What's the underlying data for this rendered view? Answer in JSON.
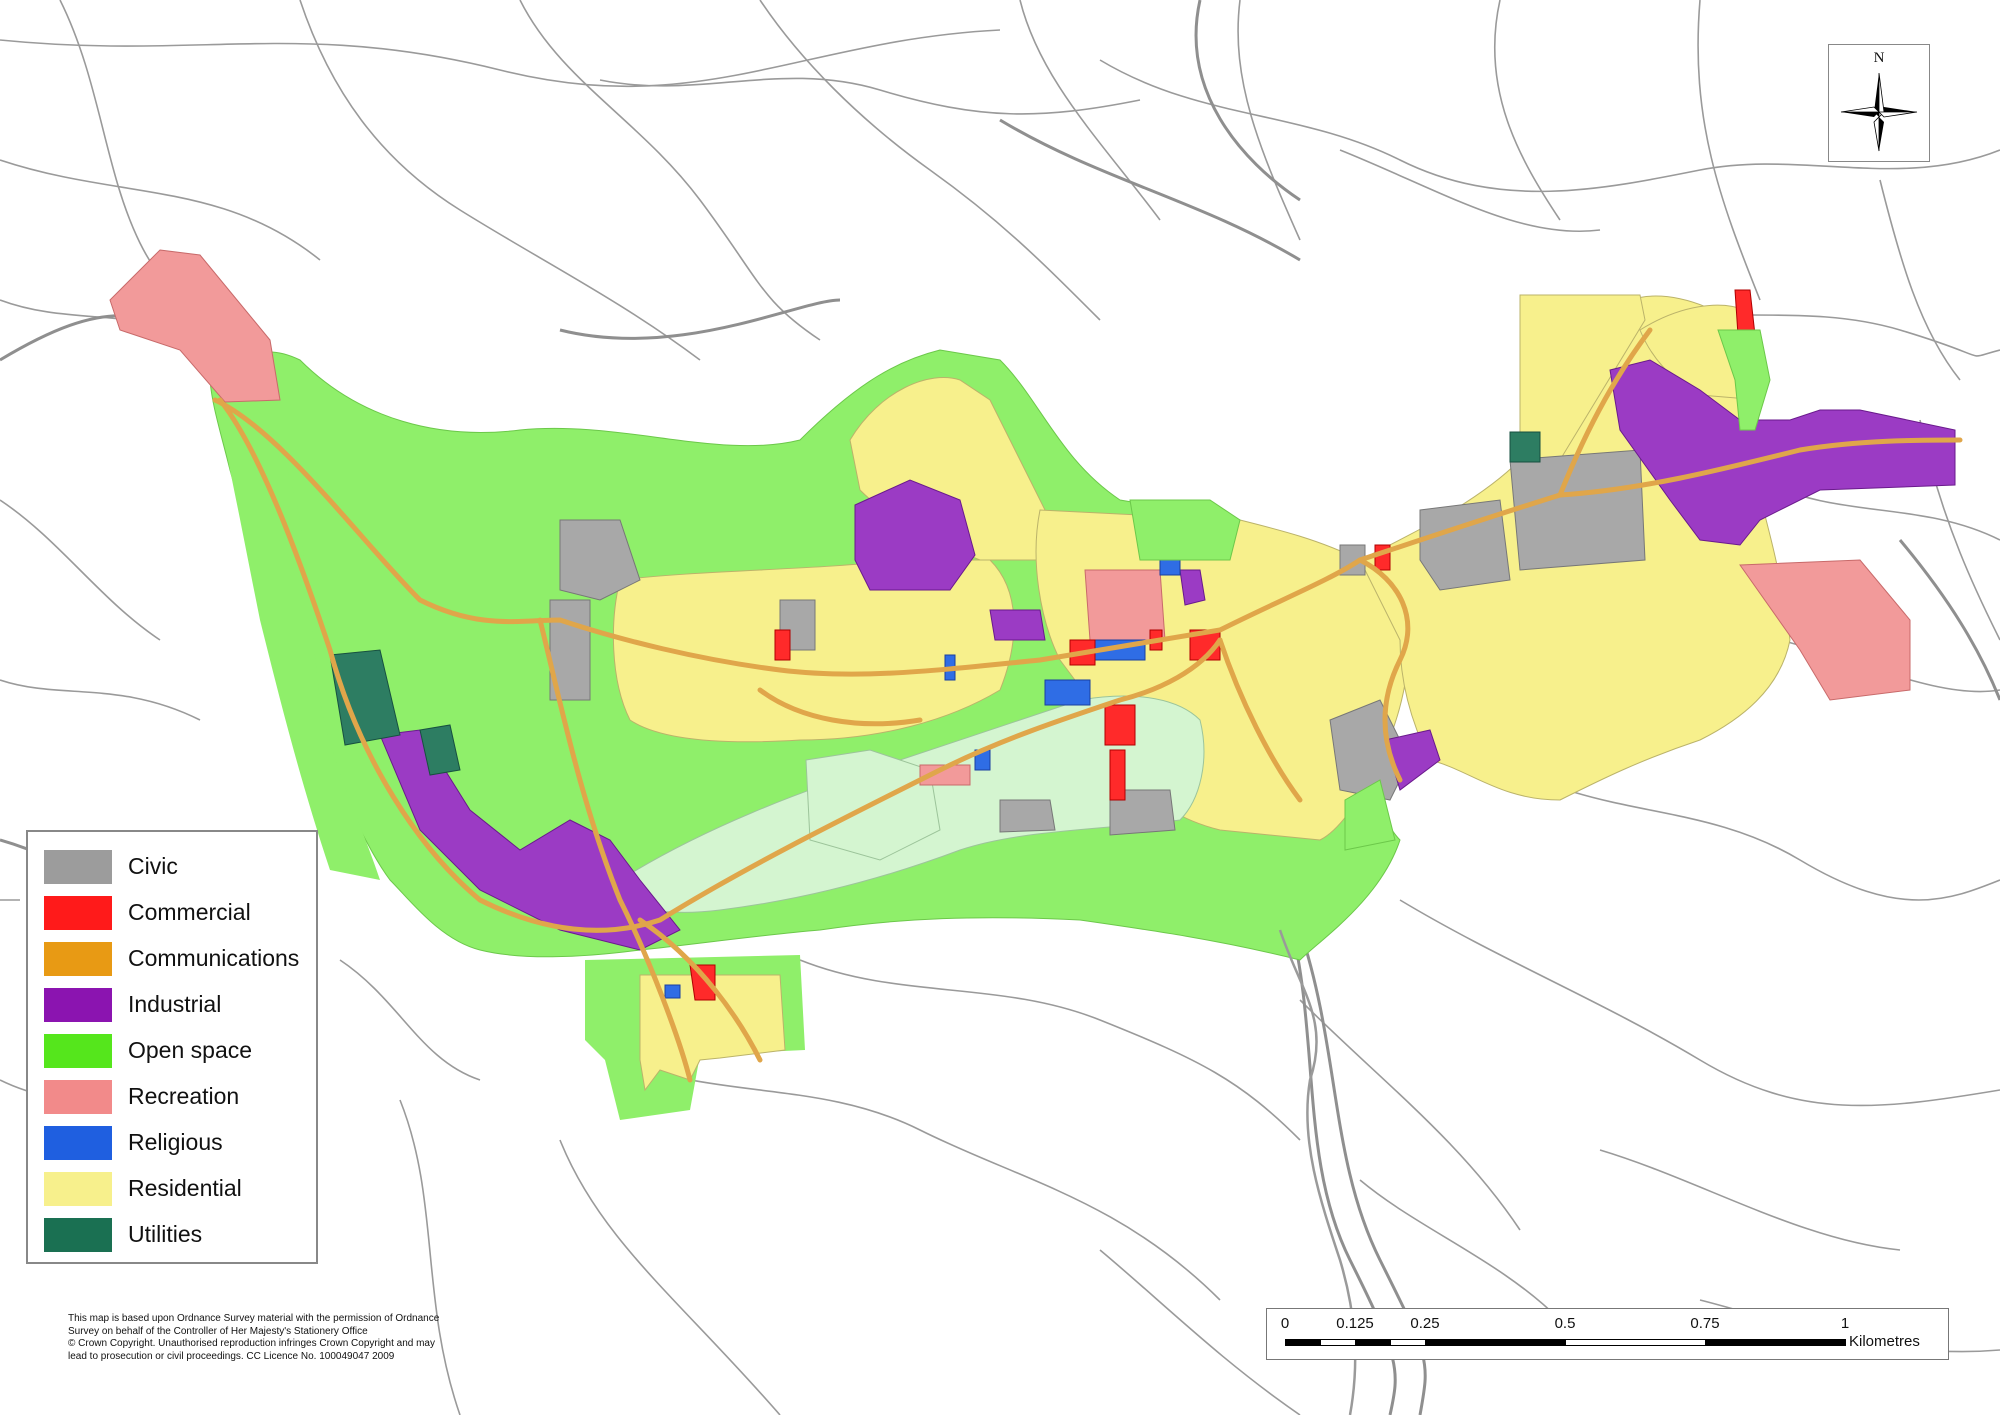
{
  "legend": {
    "items": [
      {
        "label": "Civic",
        "color": "#9c9c9c"
      },
      {
        "label": "Commercial",
        "color": "#ff1a1a"
      },
      {
        "label": "Communications",
        "color": "#e89a14"
      },
      {
        "label": "Industrial",
        "color": "#8b14b0"
      },
      {
        "label": "Open space",
        "color": "#55e61c"
      },
      {
        "label": "Recreation",
        "color": "#f28a8a"
      },
      {
        "label": "Religious",
        "color": "#1f5fe0"
      },
      {
        "label": "Residential",
        "color": "#f7f08c"
      },
      {
        "label": "Utilities",
        "color": "#1a7052"
      }
    ]
  },
  "credits": {
    "line1": "This map is based upon Ordnance Survey material with the permission of Ordnance",
    "line2": "Survey on behalf of the Controller of Her Majesty's Stationery Office",
    "line3": "© Crown Copyright. Unauthorised reproduction infringes Crown Copyright and may",
    "line4": "lead to prosecution or civil proceedings. CC Licence No. 100049047 2009"
  },
  "scale_bar": {
    "ticks": [
      "0",
      "0.125",
      "0.25",
      "0.5",
      "0.75",
      "1"
    ],
    "units": "Kilometres"
  },
  "north_arrow": {
    "label": "N"
  }
}
